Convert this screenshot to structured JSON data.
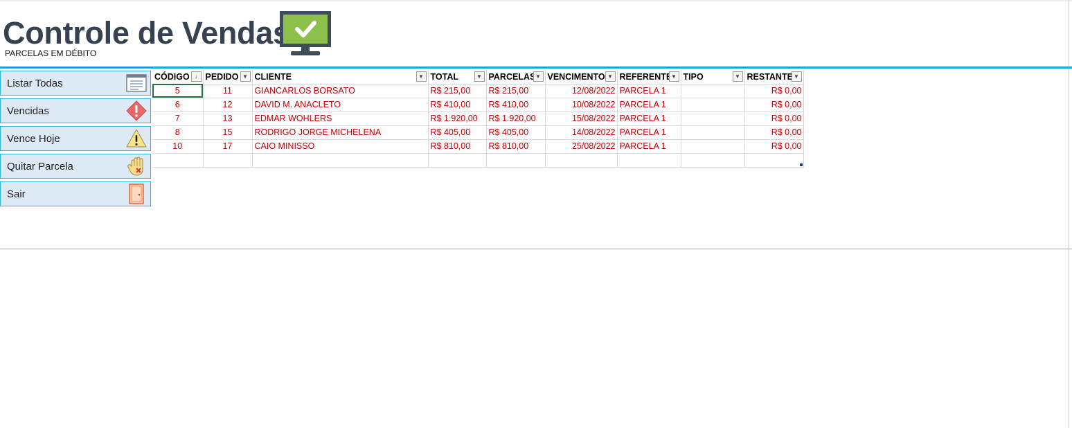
{
  "header": {
    "title": "Controle de Vendas",
    "subtitle": "PARCELAS EM DÉBITO",
    "icon": "monitor-check-icon"
  },
  "colors": {
    "accent": "#1fa3dc",
    "button_bg": "#dde9f5",
    "data_text": "#c00000",
    "title": "#374150"
  },
  "sidebar": {
    "items": [
      {
        "label": "Listar Todas",
        "icon": "list-icon"
      },
      {
        "label": "Vencidas",
        "icon": "alert-diamond-icon"
      },
      {
        "label": "Vence Hoje",
        "icon": "warning-triangle-icon"
      },
      {
        "label": "Quitar Parcela",
        "icon": "hand-stop-icon"
      },
      {
        "label": "Sair",
        "icon": "door-exit-icon"
      }
    ]
  },
  "table": {
    "columns": [
      "CÓDIGO",
      "PEDIDO",
      "CLIENTE",
      "TOTAL",
      "PARCELAS",
      "VENCIMENTO",
      "REFERENTE",
      "TIPO",
      "RESTANTE"
    ],
    "sort_indicator": "↓",
    "filter_glyph": "▼",
    "rows": [
      [
        "5",
        "11",
        "GIANCARLOS BORSATO",
        "R$ 215,00",
        "R$ 215,00",
        "12/08/2022",
        "PARCELA 1",
        "",
        "R$ 0,00"
      ],
      [
        "6",
        "12",
        "DAVID M. ANACLETO",
        "R$ 410,00",
        "R$ 410,00",
        "10/08/2022",
        "PARCELA 1",
        "",
        "R$ 0,00"
      ],
      [
        "7",
        "13",
        "EDMAR  WOHLERS",
        "R$ 1.920,00",
        "R$ 1.920,00",
        "15/08/2022",
        "PARCELA 1",
        "",
        "R$ 0,00"
      ],
      [
        "8",
        "15",
        "RODRIGO JORGE  MICHELENA",
        "R$ 405,00",
        "R$ 405,00",
        "14/08/2022",
        "PARCELA 1",
        "",
        "R$ 0,00"
      ],
      [
        "10",
        "17",
        "CAIO  MINISSO",
        "R$ 810,00",
        "R$ 810,00",
        "25/08/2022",
        "PARCELA 1",
        "",
        "R$ 0,00"
      ],
      [
        "",
        "",
        "",
        "",
        "",
        "",
        "",
        "",
        ""
      ]
    ]
  }
}
